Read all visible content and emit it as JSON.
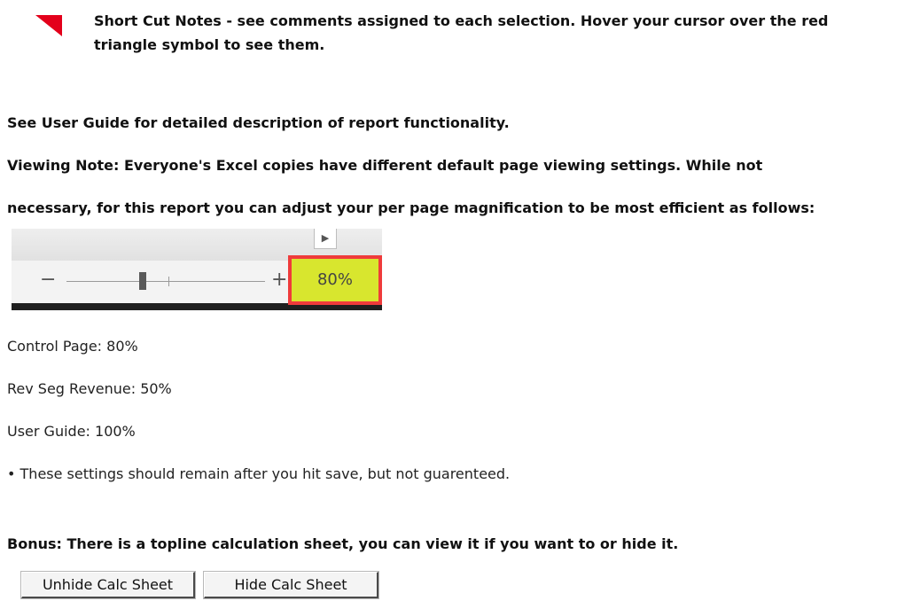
{
  "note": {
    "text": "Short Cut Notes - see comments assigned to each selection.  Hover your cursor over the red triangle symbol to see them.",
    "icon": "red-triangle-comment-marker",
    "icon_color": "#e3001b"
  },
  "user_guide_note": "See User Guide for detailed description of report functionality.",
  "viewing_note": {
    "line1": "Viewing Note:  Everyone's Excel copies have different default page viewing settings.  While not",
    "line2": "necessary, for this report you can adjust your per page magnification to be most efficient as follows:"
  },
  "zoom_control": {
    "minus": "−",
    "plus": "+",
    "scroll_arrow": "▶",
    "level": "80%",
    "slider_level_percent": 80,
    "highlight_color": "#d8e62e",
    "outline_color": "#ef3b3b"
  },
  "settings": {
    "control_page": "Control Page: 80%",
    "rev_seg_revenue": "Rev Seg Revenue: 50%",
    "user_guide": "User Guide: 100%",
    "persistence_note": "• These settings should remain after you hit save, but not guarenteed."
  },
  "bonus": "Bonus:  There is a topline calculation sheet, you can view it if you want to or hide it.",
  "buttons": {
    "unhide": "Unhide Calc Sheet",
    "hide": "Hide Calc Sheet"
  }
}
